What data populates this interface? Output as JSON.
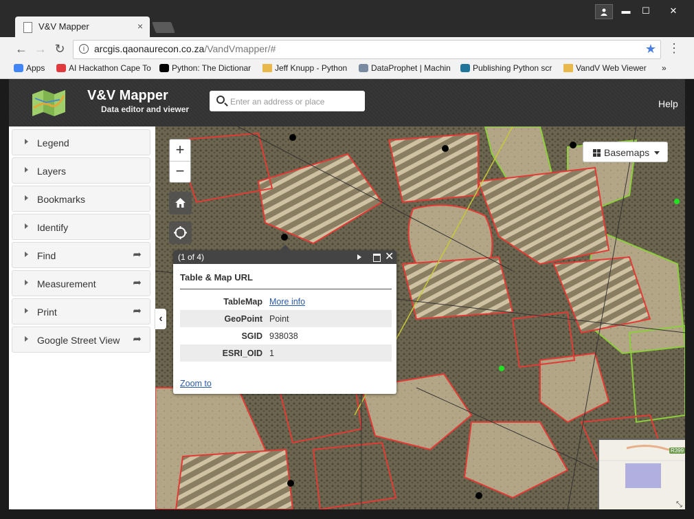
{
  "browser": {
    "tab_title": "V&V Mapper",
    "tab_close": "×",
    "url_host": "arcgis.qaonaurecon.co.za",
    "url_path": "/VandVmapper/#",
    "window_controls": {
      "minimize": "▬",
      "maximize": "☐",
      "close": "✕"
    }
  },
  "bookmarks": [
    {
      "label": "Apps",
      "icon": "apps-grid-icon",
      "color": "#4285f4"
    },
    {
      "label": "AI Hackathon Cape To",
      "icon": "meetup-icon",
      "color": "#e0393e"
    },
    {
      "label": "Python: The Dictionar",
      "icon": "bolt-icon",
      "color": "#000000"
    },
    {
      "label": "Jeff Knupp - Python",
      "icon": "folder-icon",
      "color": "#e8b84a"
    },
    {
      "label": "DataProphet | Machin",
      "icon": "dp-logo-icon",
      "color": "#7a8aa0"
    },
    {
      "label": "Publishing Python scr",
      "icon": "wordpress-icon",
      "color": "#21759b"
    },
    {
      "label": "VandV Web Viewer",
      "icon": "folder-icon",
      "color": "#e8b84a"
    },
    {
      "label": "»",
      "icon": "more-icon",
      "color": "#333333"
    }
  ],
  "app": {
    "title": "V&V Mapper",
    "subtitle": "Data editor and viewer",
    "search_placeholder": "Enter an address or place",
    "help_label": "Help"
  },
  "sidebar": {
    "items": [
      {
        "label": "Legend",
        "share": false
      },
      {
        "label": "Layers",
        "share": false
      },
      {
        "label": "Bookmarks",
        "share": false
      },
      {
        "label": "Identify",
        "share": false
      },
      {
        "label": "Find",
        "share": true
      },
      {
        "label": "Measurement",
        "share": true
      },
      {
        "label": "Print",
        "share": true
      },
      {
        "label": "Google Street View",
        "share": true
      }
    ]
  },
  "map": {
    "zoom_in": "+",
    "zoom_out": "−",
    "basemaps_label": "Basemaps",
    "overview_road_label": "R399",
    "collapse_glyph": "‹"
  },
  "popup": {
    "count": "(1 of 4)",
    "title": "Table & Map URL",
    "zoom_to": "Zoom to",
    "close": "✕",
    "attributes": [
      {
        "name": "TableMap",
        "value": "More info",
        "link": true
      },
      {
        "name": "GeoPoint",
        "value": "Point",
        "link": false
      },
      {
        "name": "SGID",
        "value": "938038",
        "link": false
      },
      {
        "name": "ESRI_OID",
        "value": "1",
        "link": false
      }
    ]
  },
  "colors": {
    "parcel_outline": "#e23a35",
    "green_outline": "#8ccf3a",
    "road_line": "#c8c83a",
    "header_bg": "#333333"
  }
}
